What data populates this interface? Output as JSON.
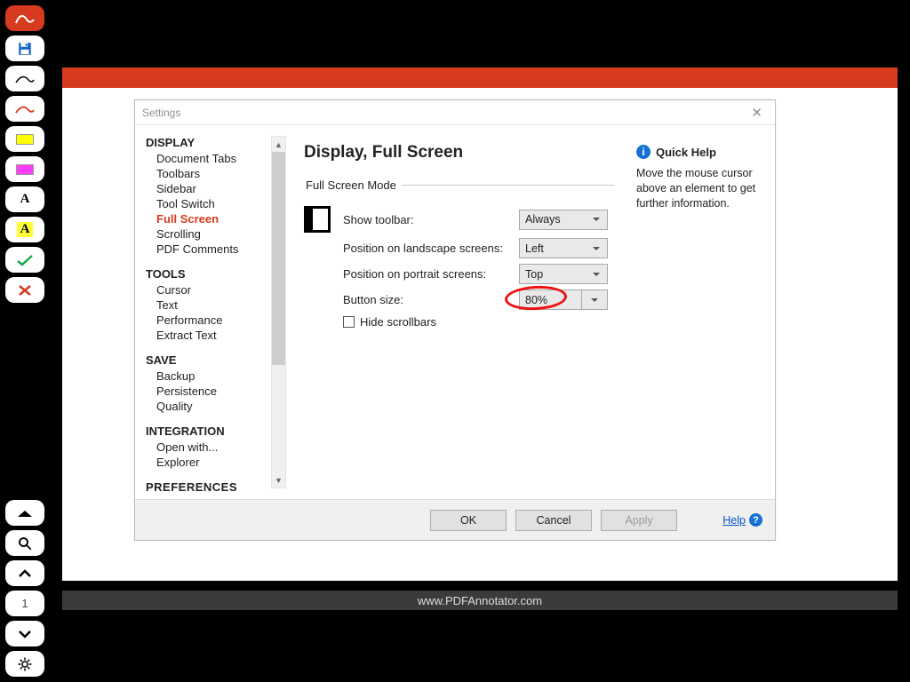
{
  "statusbar": {
    "url": "www.PDFAnnotator.com"
  },
  "toolbar_pagenum": "1",
  "dialog": {
    "title": "Settings",
    "nav": {
      "groups": [
        {
          "head": "DISPLAY",
          "items": [
            "Document Tabs",
            "Toolbars",
            "Sidebar",
            "Tool Switch",
            "Full Screen",
            "Scrolling",
            "PDF Comments"
          ],
          "selected": 4
        },
        {
          "head": "TOOLS",
          "items": [
            "Cursor",
            "Text",
            "Performance",
            "Extract Text"
          ]
        },
        {
          "head": "SAVE",
          "items": [
            "Backup",
            "Persistence",
            "Quality"
          ]
        },
        {
          "head": "INTEGRATION",
          "items": [
            "Open with...",
            "Explorer"
          ]
        },
        {
          "head": "PREFERENCES",
          "items": []
        }
      ]
    },
    "panel": {
      "heading": "Display, Full Screen",
      "fieldset_legend": "Full Screen Mode",
      "labels": {
        "show_toolbar": "Show toolbar:",
        "pos_landscape": "Position on landscape screens:",
        "pos_portrait": "Position on portrait screens:",
        "button_size": "Button size:",
        "hide_scrollbars": "Hide scrollbars"
      },
      "values": {
        "show_toolbar": "Always",
        "pos_landscape": "Left",
        "pos_portrait": "Top",
        "button_size": "80%"
      }
    },
    "info": {
      "heading": "Quick Help",
      "text": "Move the mouse cursor above an element to get further information."
    },
    "footer": {
      "ok": "OK",
      "cancel": "Cancel",
      "apply": "Apply",
      "help": "Help"
    }
  }
}
